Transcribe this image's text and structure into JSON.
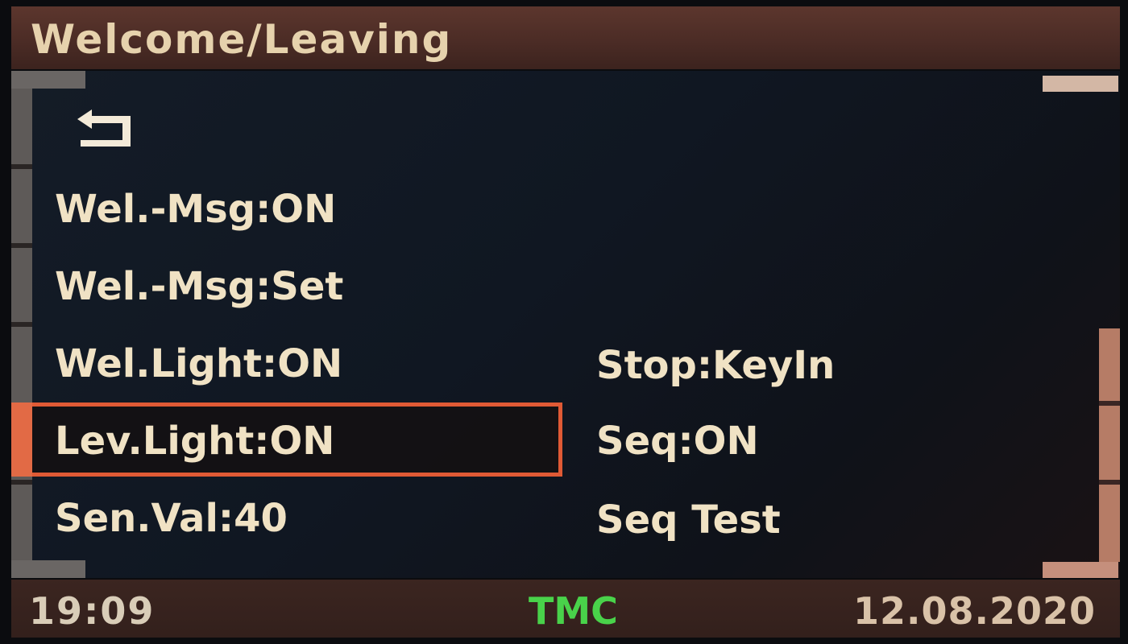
{
  "title": "Welcome/Leaving",
  "back_icon": "back-arrow-icon",
  "left_menu": [
    {
      "label": "Wel.-Msg:ON"
    },
    {
      "label": "Wel.-Msg:Set"
    },
    {
      "label": "Wel.Light:ON"
    },
    {
      "label": "Lev.Light:ON",
      "selected": true
    },
    {
      "label": "Sen.Val:40"
    }
  ],
  "right_menu": [
    {
      "label": "Stop:KeyIn"
    },
    {
      "label": "Seq:ON"
    },
    {
      "label": "Seq Test"
    }
  ],
  "status": {
    "time": "19:09",
    "source": "TMC",
    "date": "12.08.2020"
  },
  "colors": {
    "title_bar": "#4a2b25",
    "text": "#f0e2c4",
    "selection": "#e05a35",
    "tmc": "#49d24a"
  }
}
